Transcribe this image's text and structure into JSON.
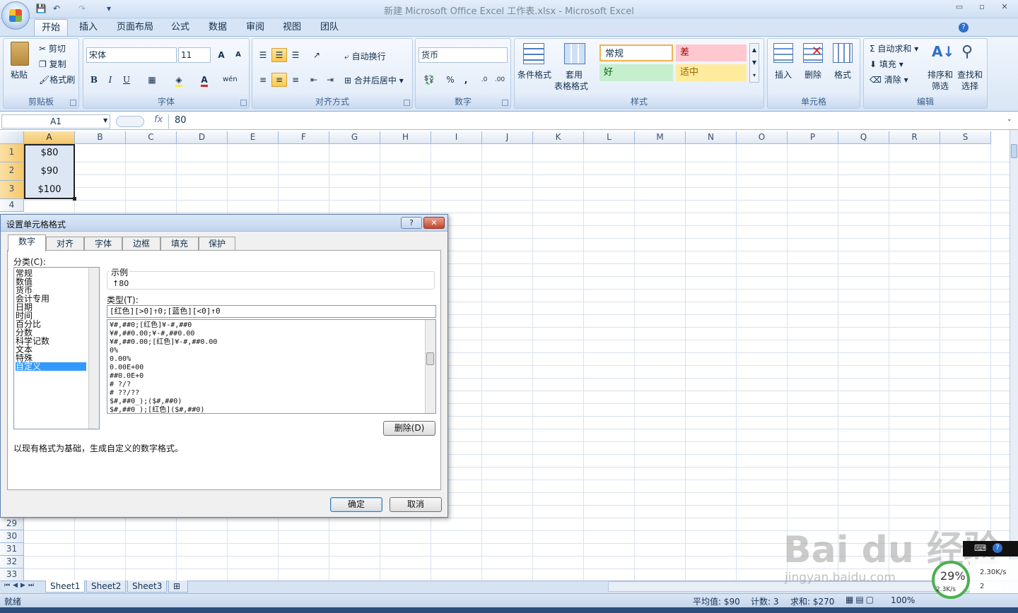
{
  "window": {
    "title": "新建 Microsoft Office Excel 工作表.xlsx - Microsoft Excel",
    "min": "▭",
    "max": "▫",
    "close": "✕"
  },
  "qat": {
    "save": "💾",
    "undo": "↶",
    "redo": "↷",
    "more": "▾"
  },
  "tabs": [
    "开始",
    "插入",
    "页面布局",
    "公式",
    "数据",
    "审阅",
    "视图",
    "团队"
  ],
  "ribbon": {
    "clipboard": {
      "paste": "粘贴",
      "cut": "剪切",
      "copy": "复制",
      "painter": "格式刷",
      "label": "剪贴板"
    },
    "font": {
      "name": "宋体",
      "size": "11",
      "grow": "A",
      "shrink": "A",
      "bold": "B",
      "italic": "I",
      "underline": "U",
      "wen": "wén",
      "label": "字体"
    },
    "align": {
      "wrap": "自动换行",
      "merge": "合并后居中",
      "label": "对齐方式"
    },
    "number": {
      "format": "货币",
      "percent": "%",
      "comma": ",",
      "inc": ".0",
      "dec": ".00",
      "label": "数字"
    },
    "styles": {
      "conditional": "条件格式",
      "table_line1": "套用",
      "table_line2": "表格格式",
      "normal": "常规",
      "bad": "差",
      "good": "好",
      "neutral": "适中",
      "label": "样式"
    },
    "cells": {
      "insert": "插入",
      "delete": "删除",
      "format": "格式",
      "label": "单元格"
    },
    "editing": {
      "autosum": "自动求和",
      "fill": "填充",
      "clear": "清除",
      "sort_l1": "排序和",
      "sort_l2": "筛选",
      "find_l1": "查找和",
      "find_l2": "选择",
      "label": "编辑"
    }
  },
  "formula_bar": {
    "name_box": "A1",
    "fx": "fx",
    "value": "80"
  },
  "columns": [
    "A",
    "B",
    "C",
    "D",
    "E",
    "F",
    "G",
    "H",
    "I",
    "J",
    "K",
    "L",
    "M",
    "N",
    "O",
    "P",
    "Q",
    "R",
    "S"
  ],
  "rows_top": [
    "1",
    "2",
    "3",
    "4"
  ],
  "rows_bottom": [
    "29",
    "30",
    "31",
    "32",
    "33"
  ],
  "cells": {
    "A1": "$80",
    "A2": "$90",
    "A3": "$100"
  },
  "sheets": [
    "Sheet1",
    "Sheet2",
    "Sheet3"
  ],
  "status": {
    "ready": "就绪",
    "average": "平均值: $90",
    "count": "计数: 3",
    "sum": "求和: $270",
    "zoom": "100%"
  },
  "dialog": {
    "title": "设置单元格格式",
    "help": "?",
    "close": "✕",
    "tabs": [
      "数字",
      "对齐",
      "字体",
      "边框",
      "填充",
      "保护"
    ],
    "category_label": "分类(C):",
    "categories": [
      "常规",
      "数值",
      "货币",
      "会计专用",
      "日期",
      "时间",
      "百分比",
      "分数",
      "科学记数",
      "文本",
      "特殊",
      "自定义"
    ],
    "sample_label": "示例",
    "sample_value": "↑80",
    "type_label": "类型(T):",
    "type_value": "[红色][>0]↑0;[蓝色][<0]↑0",
    "formats": [
      "¥#,##0;[红色]¥-#,##0",
      "¥#,##0.00;¥-#,##0.00",
      "¥#,##0.00;[红色]¥-#,##0.00",
      "0%",
      "0.00%",
      "0.00E+00",
      "##0.0E+0",
      "# ?/?",
      "# ??/??",
      "$#,##0_);($#,##0)",
      "$#,##0_);[红色]($#,##0)"
    ],
    "delete": "删除(D)",
    "description": "以现有格式为基础，生成自定义的数字格式。",
    "ok": "确定",
    "cancel": "取消"
  },
  "watermark": {
    "brand": "Bai du 经验",
    "url": "jingyan.baidu.com"
  },
  "netmeter": {
    "percent": "29%",
    "up": "2.30K/s",
    "down": "2.3K/s",
    "count": "2"
  }
}
